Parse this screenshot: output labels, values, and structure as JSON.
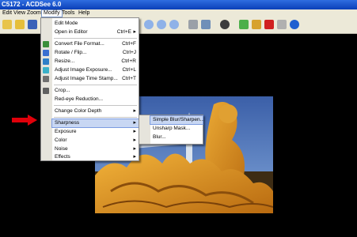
{
  "window": {
    "title": "C5172 - ACDSee 6.0"
  },
  "menubar": [
    {
      "label": "Edit",
      "active": false
    },
    {
      "label": "View",
      "active": false
    },
    {
      "label": "Zoom",
      "active": false
    },
    {
      "label": "Modify",
      "active": true
    },
    {
      "label": "Tools",
      "active": false
    },
    {
      "label": "Help",
      "active": false
    }
  ],
  "modify_menu": {
    "items": [
      {
        "label": "Edit Mode",
        "shortcut": ""
      },
      {
        "label": "Open in Editor",
        "shortcut": "Ctrl+E",
        "submenu": true
      },
      {
        "label": "Convert File Format...",
        "shortcut": "Ctrl+F"
      },
      {
        "label": "Rotate / Flip...",
        "shortcut": "Ctrl+J"
      },
      {
        "label": "Resize...",
        "shortcut": "Ctrl+R"
      },
      {
        "label": "Adjust Image Exposure...",
        "shortcut": "Ctrl+L"
      },
      {
        "label": "Adjust Image Time Stamp...",
        "shortcut": "Ctrl+T"
      },
      {
        "label": "Crop...",
        "shortcut": ""
      },
      {
        "label": "Red-eye Reduction...",
        "shortcut": ""
      },
      {
        "label": "Change Color Depth",
        "shortcut": "",
        "submenu": true
      },
      {
        "label": "Sharpness",
        "shortcut": "",
        "submenu": true
      },
      {
        "label": "Exposure",
        "shortcut": "",
        "submenu": true
      },
      {
        "label": "Color",
        "shortcut": "",
        "submenu": true
      },
      {
        "label": "Noise",
        "shortcut": "",
        "submenu": true
      },
      {
        "label": "Effects",
        "shortcut": "",
        "submenu": true
      }
    ]
  },
  "sharpness_submenu": {
    "items": [
      {
        "label": "Simple Blur/Sharpen..."
      },
      {
        "label": "Unsharp Mask..."
      },
      {
        "label": "Blur..."
      }
    ]
  },
  "colors": {
    "menu_highlight": "#c8d7f3",
    "pointer_arrow": "#e0000a"
  },
  "submenu_arrow": "▸"
}
